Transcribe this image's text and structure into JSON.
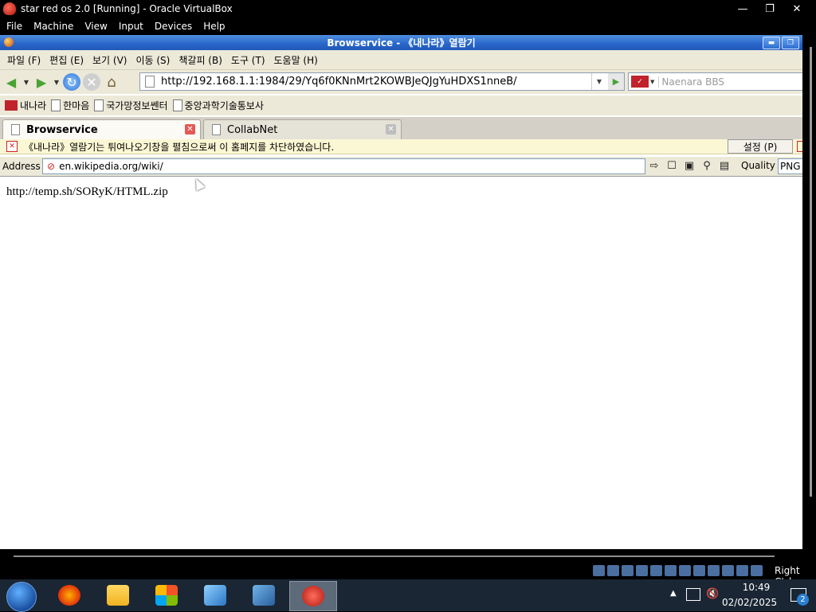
{
  "host_window": {
    "title": "star red os 2.0 [Running] - Oracle VirtualBox",
    "controls": {
      "minimize": "—",
      "restore": "❐",
      "close": "✕"
    },
    "menu": [
      "File",
      "Machine",
      "View",
      "Input",
      "Devices",
      "Help"
    ]
  },
  "browser": {
    "title": "Browservice - 《내나라》열람기",
    "menu": [
      "파일 (F)",
      "편집 (E)",
      "보기 (V)",
      "이동 (S)",
      "책갈피 (B)",
      "도구 (T)",
      "도움말 (H)"
    ],
    "url": "http://192.168.1.1:1984/29/Yq6f0KNnMrt2KOWBJeQJgYuHDXS1nneB/",
    "search_placeholder": "Naenara BBS",
    "bookmarks": [
      "내나라",
      "한마음",
      "국가망정보쎈터",
      "중앙과학기술통보사"
    ],
    "tabs": [
      {
        "label": "Browservice",
        "active": true
      },
      {
        "label": "CollabNet",
        "active": false
      }
    ],
    "infobar": {
      "message": "《내나라》열람기는 튀여나오기창을 펼침으로써 이 홈페지를 차단하였습니다.",
      "button": "설정 (P)"
    },
    "address_bar": {
      "label": "Address",
      "value": "en.wikipedia.org/wiki/",
      "quality_label": "Quality",
      "format": "PNG"
    },
    "content_text": "http://temp.sh/SORyK/HTML.zip"
  },
  "status": {
    "host_key": "Right Ctrl"
  },
  "taskbar": {
    "time": "10:49",
    "date": "02/02/2025",
    "notifications": "2"
  }
}
